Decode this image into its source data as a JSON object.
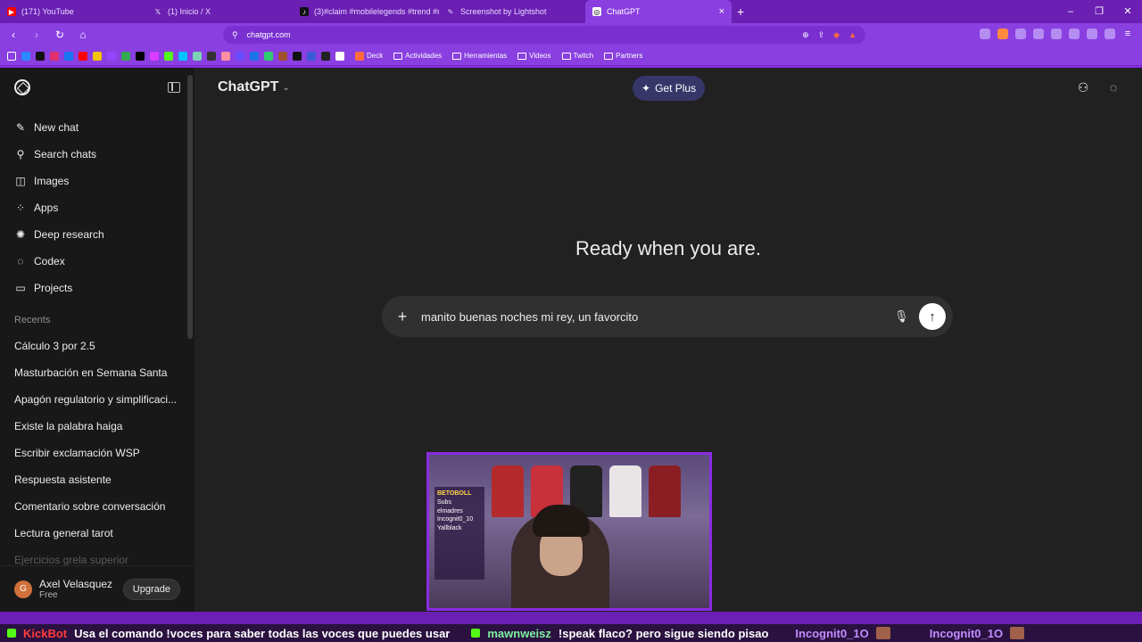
{
  "browser": {
    "tabs": [
      {
        "title": "(171) YouTube",
        "favicon_color": "#ff0000",
        "active": false
      },
      {
        "title": "(1) Inicio / X",
        "favicon_color": "#000000",
        "active": false
      },
      {
        "title": "(3)#claim #mobilelegends #trend #m",
        "favicon_color": "#111111",
        "active": false
      },
      {
        "title": "Screenshot by Lightshot",
        "favicon_color": "#b58cf2",
        "active": false
      },
      {
        "title": "ChatGPT",
        "favicon_color": "#ffffff",
        "active": true
      }
    ],
    "url": "chatgpt.com",
    "bookmarks": [
      {
        "label": "Deck"
      },
      {
        "label": "Actividades"
      },
      {
        "label": "Herramientas"
      },
      {
        "label": "Videos"
      },
      {
        "label": "Twitch"
      },
      {
        "label": "Partners"
      }
    ]
  },
  "sidebar": {
    "nav": [
      {
        "label": "New chat",
        "icon": "edit-icon"
      },
      {
        "label": "Search chats",
        "icon": "search-icon"
      },
      {
        "label": "Images",
        "icon": "images-icon"
      },
      {
        "label": "Apps",
        "icon": "apps-icon"
      },
      {
        "label": "Deep research",
        "icon": "deep-research-icon"
      },
      {
        "label": "Codex",
        "icon": "codex-icon"
      },
      {
        "label": "Projects",
        "icon": "folder-icon"
      }
    ],
    "recents_label": "Recents",
    "recents": [
      "Cálculo 3 por 2.5",
      "Masturbación en Semana Santa",
      "Apagón regulatorio y simplificaci...",
      "Existe la palabra haiga",
      "Escribir exclamación WSP",
      "Respuesta asistente",
      "Comentario sobre conversación",
      "Lectura general tarot",
      "Ejercicios grela superior"
    ],
    "user": {
      "initial": "G",
      "name": "Axel Velasquez",
      "plan": "Free",
      "upgrade_label": "Upgrade"
    }
  },
  "main": {
    "model_label": "ChatGPT",
    "get_plus_label": "Get Plus",
    "headline": "Ready when you are.",
    "composer_text": "manito buenas noches mi rey, un favorcito"
  },
  "stream": {
    "webcam_lines": [
      "BETOBOLL",
      "Subs",
      "elmadres",
      "Incognit0_10",
      "Yallblack"
    ],
    "ticker": [
      {
        "user": "KickBot",
        "message": "Usa el comando !voces para saber todas las voces que puedes usar"
      },
      {
        "user": "mawnweisz",
        "message": "!speak flaco? pero sigue siendo pisao"
      },
      {
        "user": "Incognit0_1O",
        "message": ""
      },
      {
        "user": "Incognit0_1O",
        "message": ""
      }
    ]
  }
}
